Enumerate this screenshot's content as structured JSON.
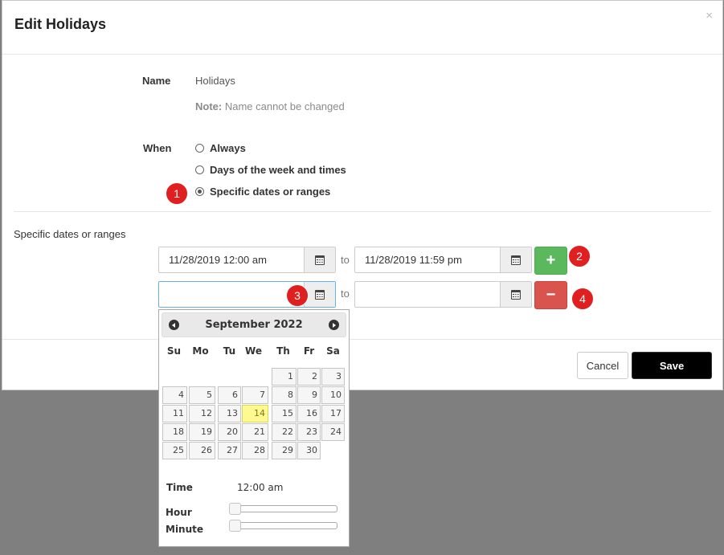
{
  "modal": {
    "title": "Edit Holidays",
    "close_glyph": "×",
    "name_label": "Name",
    "name_value": "Holidays",
    "note_bold": "Note:",
    "note_text": " Name cannot be changed",
    "when_label": "When",
    "options": [
      {
        "label": "Always",
        "checked": false
      },
      {
        "label": "Days of the week and times",
        "checked": false
      },
      {
        "label": "Specific dates or ranges",
        "checked": true
      }
    ],
    "section_title": "Specific dates or ranges",
    "ranges": [
      {
        "from": "11/28/2019 12:00 am",
        "to_word": "to",
        "to": "11/28/2019 11:59 pm",
        "action": "add-icon"
      },
      {
        "from": "",
        "to_word": "to",
        "to": "",
        "action": "remove-icon"
      }
    ],
    "add_glyph": "+",
    "remove_glyph": "−",
    "cancel_label": "Cancel",
    "save_label": "Save"
  },
  "badges": [
    "1",
    "2",
    "3",
    "4"
  ],
  "datepicker": {
    "month_year": "September 2022",
    "weekdays": [
      "Su",
      "Mo",
      "Tu",
      "We",
      "Th",
      "Fr",
      "Sa"
    ],
    "first_weekday_index": 4,
    "days_in_month": 30,
    "today": 14,
    "time_label": "Time",
    "time_value": "12:00 am",
    "hour_label": "Hour",
    "minute_label": "Minute",
    "hour_value": 0,
    "minute_value": 0
  },
  "colors": {
    "add": "#5cb85c",
    "remove": "#d9534f",
    "badge": "#e02020",
    "today": "#fffa90"
  },
  "icons": [
    "calendar-icon",
    "plus-icon",
    "minus-icon",
    "prev-month-icon",
    "next-month-icon",
    "close-icon"
  ]
}
